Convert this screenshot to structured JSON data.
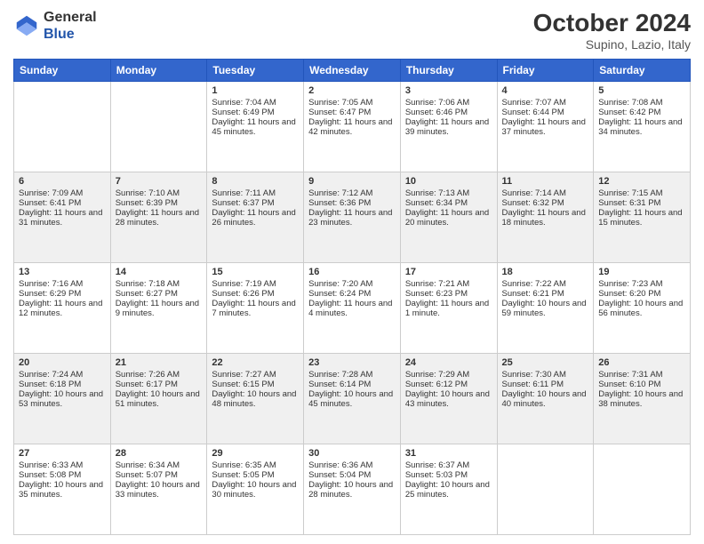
{
  "header": {
    "logo": {
      "line1": "General",
      "line2": "Blue"
    },
    "title": "October 2024",
    "location": "Supino, Lazio, Italy"
  },
  "weekdays": [
    "Sunday",
    "Monday",
    "Tuesday",
    "Wednesday",
    "Thursday",
    "Friday",
    "Saturday"
  ],
  "weeks": [
    [
      {
        "day": "",
        "content": ""
      },
      {
        "day": "",
        "content": ""
      },
      {
        "day": "1",
        "content": "Sunrise: 7:04 AM\nSunset: 6:49 PM\nDaylight: 11 hours and 45 minutes."
      },
      {
        "day": "2",
        "content": "Sunrise: 7:05 AM\nSunset: 6:47 PM\nDaylight: 11 hours and 42 minutes."
      },
      {
        "day": "3",
        "content": "Sunrise: 7:06 AM\nSunset: 6:46 PM\nDaylight: 11 hours and 39 minutes."
      },
      {
        "day": "4",
        "content": "Sunrise: 7:07 AM\nSunset: 6:44 PM\nDaylight: 11 hours and 37 minutes."
      },
      {
        "day": "5",
        "content": "Sunrise: 7:08 AM\nSunset: 6:42 PM\nDaylight: 11 hours and 34 minutes."
      }
    ],
    [
      {
        "day": "6",
        "content": "Sunrise: 7:09 AM\nSunset: 6:41 PM\nDaylight: 11 hours and 31 minutes."
      },
      {
        "day": "7",
        "content": "Sunrise: 7:10 AM\nSunset: 6:39 PM\nDaylight: 11 hours and 28 minutes."
      },
      {
        "day": "8",
        "content": "Sunrise: 7:11 AM\nSunset: 6:37 PM\nDaylight: 11 hours and 26 minutes."
      },
      {
        "day": "9",
        "content": "Sunrise: 7:12 AM\nSunset: 6:36 PM\nDaylight: 11 hours and 23 minutes."
      },
      {
        "day": "10",
        "content": "Sunrise: 7:13 AM\nSunset: 6:34 PM\nDaylight: 11 hours and 20 minutes."
      },
      {
        "day": "11",
        "content": "Sunrise: 7:14 AM\nSunset: 6:32 PM\nDaylight: 11 hours and 18 minutes."
      },
      {
        "day": "12",
        "content": "Sunrise: 7:15 AM\nSunset: 6:31 PM\nDaylight: 11 hours and 15 minutes."
      }
    ],
    [
      {
        "day": "13",
        "content": "Sunrise: 7:16 AM\nSunset: 6:29 PM\nDaylight: 11 hours and 12 minutes."
      },
      {
        "day": "14",
        "content": "Sunrise: 7:18 AM\nSunset: 6:27 PM\nDaylight: 11 hours and 9 minutes."
      },
      {
        "day": "15",
        "content": "Sunrise: 7:19 AM\nSunset: 6:26 PM\nDaylight: 11 hours and 7 minutes."
      },
      {
        "day": "16",
        "content": "Sunrise: 7:20 AM\nSunset: 6:24 PM\nDaylight: 11 hours and 4 minutes."
      },
      {
        "day": "17",
        "content": "Sunrise: 7:21 AM\nSunset: 6:23 PM\nDaylight: 11 hours and 1 minute."
      },
      {
        "day": "18",
        "content": "Sunrise: 7:22 AM\nSunset: 6:21 PM\nDaylight: 10 hours and 59 minutes."
      },
      {
        "day": "19",
        "content": "Sunrise: 7:23 AM\nSunset: 6:20 PM\nDaylight: 10 hours and 56 minutes."
      }
    ],
    [
      {
        "day": "20",
        "content": "Sunrise: 7:24 AM\nSunset: 6:18 PM\nDaylight: 10 hours and 53 minutes."
      },
      {
        "day": "21",
        "content": "Sunrise: 7:26 AM\nSunset: 6:17 PM\nDaylight: 10 hours and 51 minutes."
      },
      {
        "day": "22",
        "content": "Sunrise: 7:27 AM\nSunset: 6:15 PM\nDaylight: 10 hours and 48 minutes."
      },
      {
        "day": "23",
        "content": "Sunrise: 7:28 AM\nSunset: 6:14 PM\nDaylight: 10 hours and 45 minutes."
      },
      {
        "day": "24",
        "content": "Sunrise: 7:29 AM\nSunset: 6:12 PM\nDaylight: 10 hours and 43 minutes."
      },
      {
        "day": "25",
        "content": "Sunrise: 7:30 AM\nSunset: 6:11 PM\nDaylight: 10 hours and 40 minutes."
      },
      {
        "day": "26",
        "content": "Sunrise: 7:31 AM\nSunset: 6:10 PM\nDaylight: 10 hours and 38 minutes."
      }
    ],
    [
      {
        "day": "27",
        "content": "Sunrise: 6:33 AM\nSunset: 5:08 PM\nDaylight: 10 hours and 35 minutes."
      },
      {
        "day": "28",
        "content": "Sunrise: 6:34 AM\nSunset: 5:07 PM\nDaylight: 10 hours and 33 minutes."
      },
      {
        "day": "29",
        "content": "Sunrise: 6:35 AM\nSunset: 5:05 PM\nDaylight: 10 hours and 30 minutes."
      },
      {
        "day": "30",
        "content": "Sunrise: 6:36 AM\nSunset: 5:04 PM\nDaylight: 10 hours and 28 minutes."
      },
      {
        "day": "31",
        "content": "Sunrise: 6:37 AM\nSunset: 5:03 PM\nDaylight: 10 hours and 25 minutes."
      },
      {
        "day": "",
        "content": ""
      },
      {
        "day": "",
        "content": ""
      }
    ]
  ]
}
